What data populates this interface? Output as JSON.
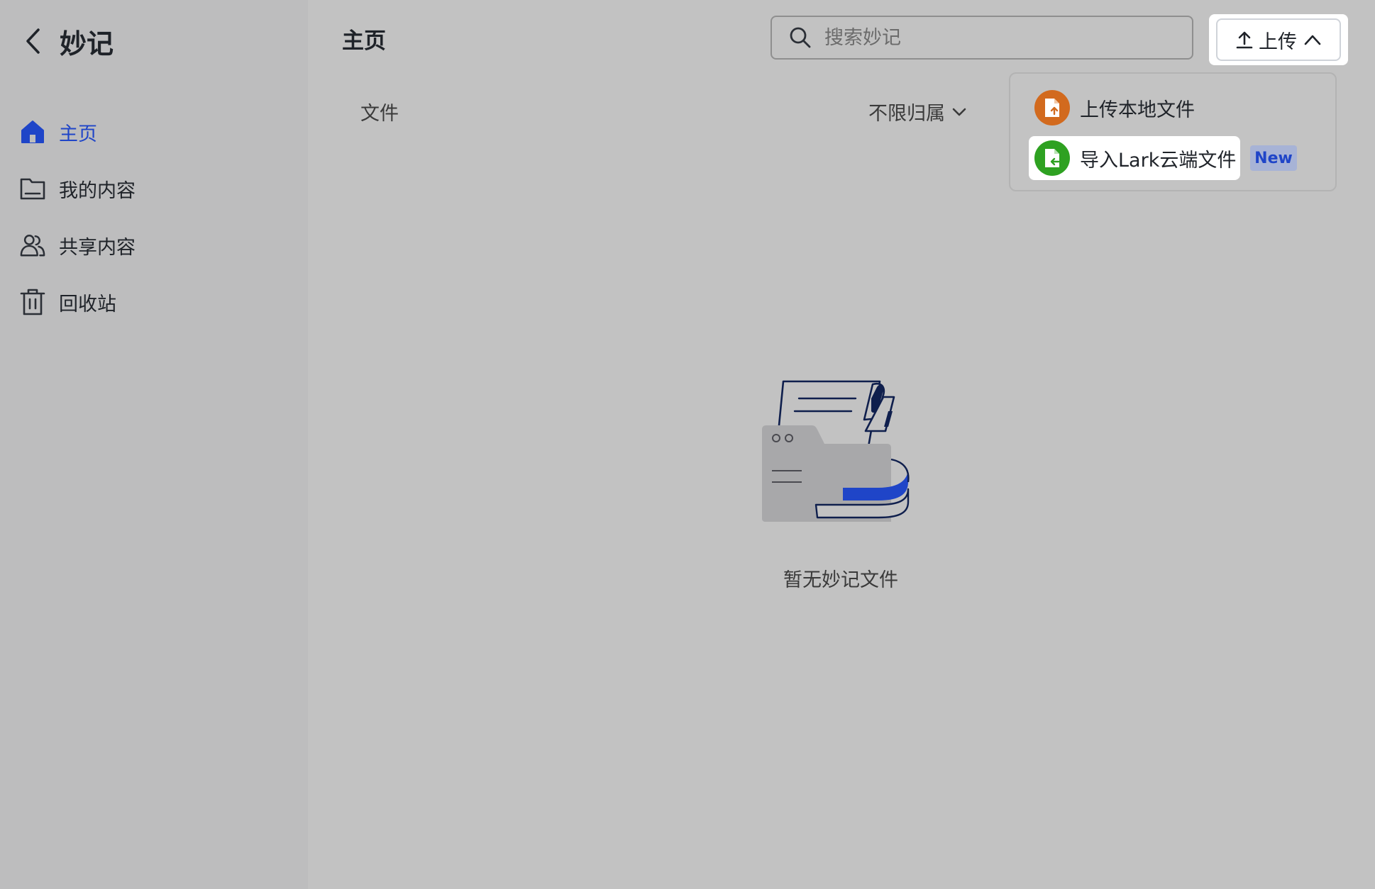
{
  "app": {
    "title": "妙记"
  },
  "sidebar": {
    "items": [
      {
        "label": "主页",
        "icon": "home-icon",
        "active": true
      },
      {
        "label": "我的内容",
        "icon": "folder-icon",
        "active": false
      },
      {
        "label": "共享内容",
        "icon": "users-icon",
        "active": false
      },
      {
        "label": "回收站",
        "icon": "trash-icon",
        "active": false
      }
    ]
  },
  "header": {
    "title": "主页",
    "search_placeholder": "搜索妙记",
    "upload_label": "上传"
  },
  "content": {
    "tab_label": "文件",
    "filter_label": "不限归属",
    "empty_text": "暂无妙记文件"
  },
  "upload_menu": {
    "items": [
      {
        "label": "上传本地文件",
        "icon": "local-file-upload-icon",
        "color": "#d26a1e"
      },
      {
        "label": "导入Lark云端文件",
        "icon": "cloud-file-import-icon",
        "color": "#2ea121",
        "badge": "New"
      }
    ]
  },
  "colors": {
    "accent": "#1f45c8",
    "background": "#c2c2c2",
    "sidebar": "#bdbdbe"
  }
}
